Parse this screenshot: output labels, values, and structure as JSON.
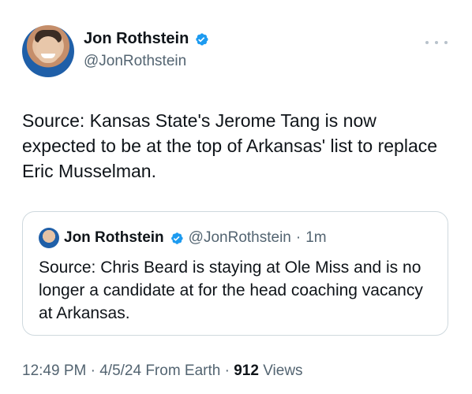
{
  "tweet": {
    "author_name": "Jon Rothstein",
    "author_handle": "@JonRothstein",
    "text": "Source: Kansas State's Jerome Tang is now expected to be at the top of Arkansas' list to replace Eric Musselman.",
    "more_icon": "more-dots-icon",
    "verified_icon": "verified-badge-icon"
  },
  "quoted": {
    "author_name": "Jon Rothstein",
    "author_handle": "@JonRothstein",
    "separator": "·",
    "time": "1m",
    "text": "Source: Chris Beard is staying at Ole Miss and is no longer a candidate at for the head coaching vacancy at Arkansas."
  },
  "meta": {
    "time": "12:49 PM",
    "sep1": "·",
    "date": "4/5/24 From Earth",
    "sep2": "·",
    "views_count": "912",
    "views_label": "Views"
  },
  "colors": {
    "verified_blue": "#1d9bf0",
    "secondary_text": "#536471",
    "border": "#cfd9de"
  }
}
